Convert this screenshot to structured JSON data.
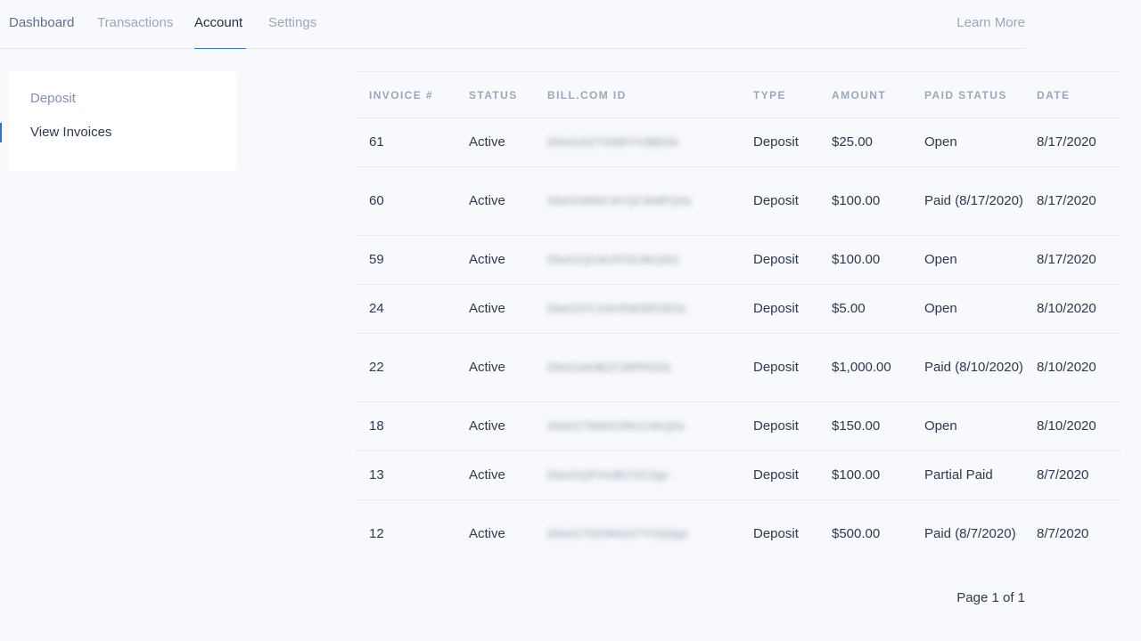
{
  "nav": {
    "tabs": [
      "Dashboard",
      "Transactions",
      "Account",
      "Settings"
    ],
    "active_tab": "Account",
    "learn_more": "Learn More"
  },
  "sidebar": {
    "items": [
      "Deposit",
      "View Invoices"
    ],
    "active_item": "View Invoices"
  },
  "table": {
    "headers": [
      "INVOICE #",
      "STATUS",
      "BILL.COM ID",
      "TYPE",
      "AMOUNT",
      "PAID STATUS",
      "DATE"
    ],
    "rows": [
      {
        "invoice": "61",
        "status": "Active",
        "bill_id": "00e01A2TO6BYX3BE0lr",
        "type": "Deposit",
        "amount": "$25.00",
        "paid_status": "Open",
        "date": "8/17/2020"
      },
      {
        "invoice": "60",
        "status": "Active",
        "bill_id": "00e01MWCAYQCAMPQ0s",
        "type": "Deposit",
        "amount": "$100.00",
        "paid_status": "Paid (8/17/2020)",
        "date": "8/17/2020"
      },
      {
        "invoice": "59",
        "status": "Active",
        "bill_id": "00e01QUAUFOC8KQ0rj",
        "type": "Deposit",
        "amount": "$100.00",
        "paid_status": "Open",
        "date": "8/17/2020"
      },
      {
        "invoice": "24",
        "status": "Active",
        "bill_id": "00e01FCXAH5WSRGE0s",
        "type": "Deposit",
        "amount": "$5.00",
        "paid_status": "Open",
        "date": "8/10/2020"
      },
      {
        "invoice": "22",
        "status": "Active",
        "bill_id": "00e01AHBZCWPRG0s",
        "type": "Deposit",
        "amount": "$1,000.00",
        "paid_status": "Paid (8/10/2020)",
        "date": "8/10/2020"
      },
      {
        "invoice": "18",
        "status": "Active",
        "bill_id": "00e01T9NDCRKCHKQ0s",
        "type": "Deposit",
        "amount": "$150.00",
        "paid_status": "Open",
        "date": "8/10/2020"
      },
      {
        "invoice": "13",
        "status": "Active",
        "bill_id": "00e01QFHUBCOC0gs",
        "type": "Deposit",
        "amount": "$100.00",
        "paid_status": "Partial Paid",
        "date": "8/7/2020"
      },
      {
        "invoice": "12",
        "status": "Active",
        "bill_id": "00e01TDOWGSTYOQ0gs",
        "type": "Deposit",
        "amount": "$500.00",
        "paid_status": "Paid (8/7/2020)",
        "date": "8/7/2020"
      }
    ]
  },
  "pagination": {
    "text": "Page 1 of 1"
  },
  "colors": {
    "accent": "#2f6fd6",
    "background": "#f7f9fc",
    "muted_text": "#9aa8ba"
  }
}
